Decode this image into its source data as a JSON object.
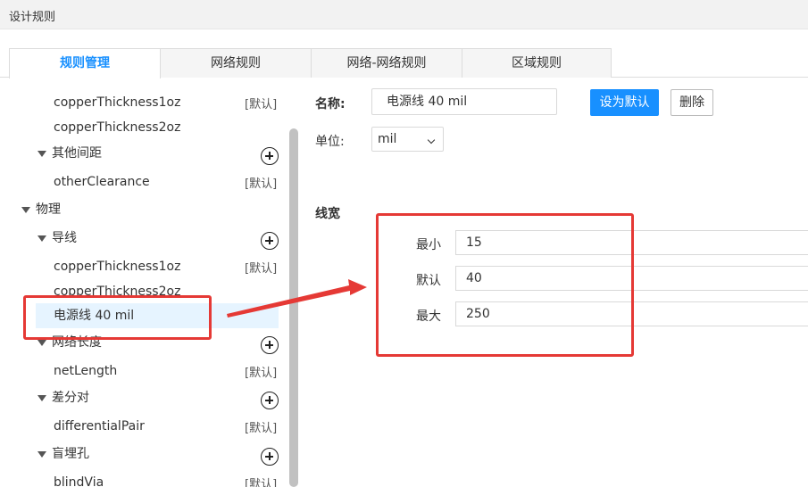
{
  "window": {
    "title": "设计规则"
  },
  "tabs": [
    {
      "label": "规则管理",
      "active": true
    },
    {
      "label": "网络规则",
      "active": false
    },
    {
      "label": "网络-网络规则",
      "active": false
    },
    {
      "label": "区域规则",
      "active": false
    }
  ],
  "tree": {
    "default_tag": "[默认]",
    "items": [
      {
        "label": "copperThickness1oz",
        "tag": "[默认]"
      },
      {
        "label": "copperThickness2oz"
      },
      {
        "label": "其他间距"
      },
      {
        "label": "otherClearance",
        "tag": "[默认]"
      },
      {
        "label": "物理"
      },
      {
        "label": "导线"
      },
      {
        "label": "copperThickness1oz",
        "tag": "[默认]"
      },
      {
        "label": "copperThickness2oz"
      },
      {
        "label": "电源线 40 mil",
        "selected": true
      },
      {
        "label": "网络长度"
      },
      {
        "label": "netLength",
        "tag": "[默认]"
      },
      {
        "label": "差分对"
      },
      {
        "label": "differentialPair",
        "tag": "[默认]"
      },
      {
        "label": "盲埋孔"
      },
      {
        "label": "blindVia",
        "tag": "[默认]"
      }
    ]
  },
  "form": {
    "name_label": "名称:",
    "name_value": "电源线 40 mil",
    "set_default_button": "设为默认",
    "delete_button": "删除",
    "unit_label": "单位:",
    "unit_value": "mil",
    "section_title": "线宽",
    "width": {
      "min_label": "最小",
      "min_value": "15",
      "default_label": "默认",
      "default_value": "40",
      "max_label": "最大",
      "max_value": "250"
    }
  },
  "colors": {
    "accent": "#1890ff",
    "annotation": "#e53935",
    "selected_bg": "#e6f4ff"
  }
}
